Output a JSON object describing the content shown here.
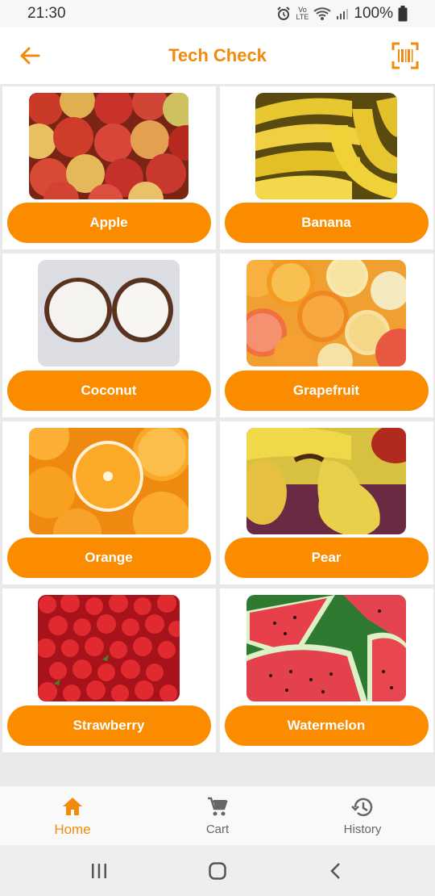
{
  "status": {
    "time": "21:30",
    "battery": "100%",
    "volte_top": "Vo",
    "volte_bottom": "LTE"
  },
  "header": {
    "title": "Tech Check",
    "back_icon": "arrow-back-icon",
    "scan_icon": "barcode-scan-icon"
  },
  "products": [
    {
      "label": "Apple"
    },
    {
      "label": "Banana"
    },
    {
      "label": "Coconut"
    },
    {
      "label": "Grapefruit"
    },
    {
      "label": "Orange"
    },
    {
      "label": "Pear"
    },
    {
      "label": "Strawberry"
    },
    {
      "label": "Watermelon"
    }
  ],
  "nav": {
    "home": "Home",
    "cart": "Cart",
    "history": "History"
  },
  "colors": {
    "accent": "#f28a0c",
    "button": "#fb8c00"
  }
}
